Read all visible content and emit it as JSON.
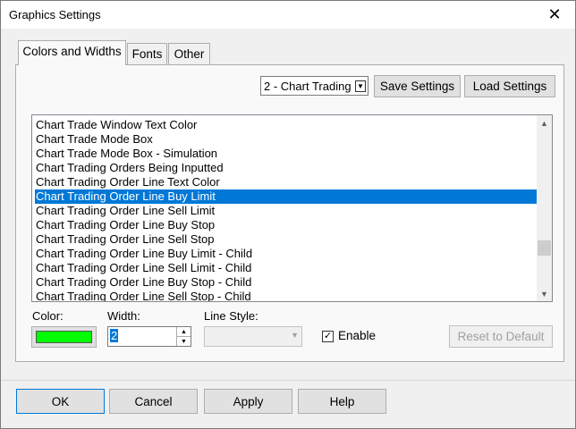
{
  "window": {
    "title": "Graphics Settings",
    "close_glyph": "✕"
  },
  "tabs": [
    {
      "label": "Colors and Widths"
    },
    {
      "label": "Fonts"
    },
    {
      "label": "Other"
    }
  ],
  "toolbar": {
    "preset_value": "2 - Chart Trading",
    "save_label": "Save Settings",
    "load_label": "Load Settings"
  },
  "list": {
    "items": [
      "Chart Trade Window Text Color",
      "Chart Trade Mode Box",
      "Chart Trade Mode Box - Simulation",
      "Chart Trading Orders Being Inputted",
      "Chart Trading Order Line Text Color",
      "Chart Trading Order Line Buy Limit",
      "Chart Trading Order Line Sell Limit",
      "Chart Trading Order Line Buy Stop",
      "Chart Trading Order Line Sell Stop",
      "Chart Trading Order Line Buy Limit - Child",
      "Chart Trading Order Line Sell Limit - Child",
      "Chart Trading Order Line Buy Stop - Child",
      "Chart Trading Order Line Sell Stop - Child"
    ],
    "selected_index": 5
  },
  "controls": {
    "color_label": "Color:",
    "color_value": "#00ff00",
    "width_label": "Width:",
    "width_value": "2",
    "line_style_label": "Line Style:",
    "enable_label": "Enable",
    "enable_checked": true,
    "reset_label": "Reset to Default"
  },
  "footer": {
    "ok_label": "OK",
    "cancel_label": "Cancel",
    "apply_label": "Apply",
    "help_label": "Help"
  },
  "icons": {
    "scroll_up": "▲",
    "scroll_down": "▼",
    "dropdown": "▼",
    "check": "✓"
  },
  "colors": {
    "selection": "#0078d7",
    "focus_border": "#0078d7"
  }
}
